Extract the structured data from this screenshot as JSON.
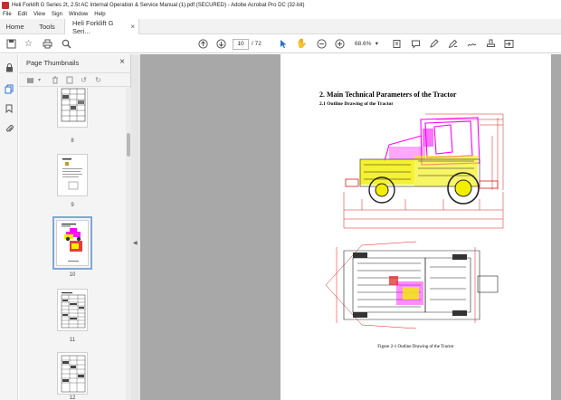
{
  "window": {
    "title": "Heli Forklift G Series 2t, 2.5t AC Internal  Operation & Service Manual   (1).pdf (SECURED) - Adobe Acrobat Pro DC (32-bit)"
  },
  "menu": [
    "File",
    "Edit",
    "View",
    "Sign",
    "Window",
    "Help"
  ],
  "tabs": {
    "home": "Home",
    "tools": "Tools",
    "document": "Heli Forklift G Seri..."
  },
  "toolbar": {
    "current_page": "10",
    "total_pages": "/ 72",
    "zoom": "68.6%"
  },
  "thumbnails": {
    "title": "Page Thumbnails",
    "pages": [
      {
        "label": "8"
      },
      {
        "label": "9"
      },
      {
        "label": "10",
        "selected": true
      },
      {
        "label": "11"
      },
      {
        "label": "12"
      }
    ]
  },
  "document": {
    "section_title": "2. Main Technical Parameters of the Tractor",
    "subsection_title": "2.1 Outline Drawing of the Tractor",
    "figure_caption": "Figure 2-1 Outline Drawing of the Tractor"
  },
  "colors": {
    "accent": "#2b6fcf",
    "magenta": "#ff00ff",
    "yellow": "#f2ee00",
    "drawing_red": "#e11b1b"
  }
}
